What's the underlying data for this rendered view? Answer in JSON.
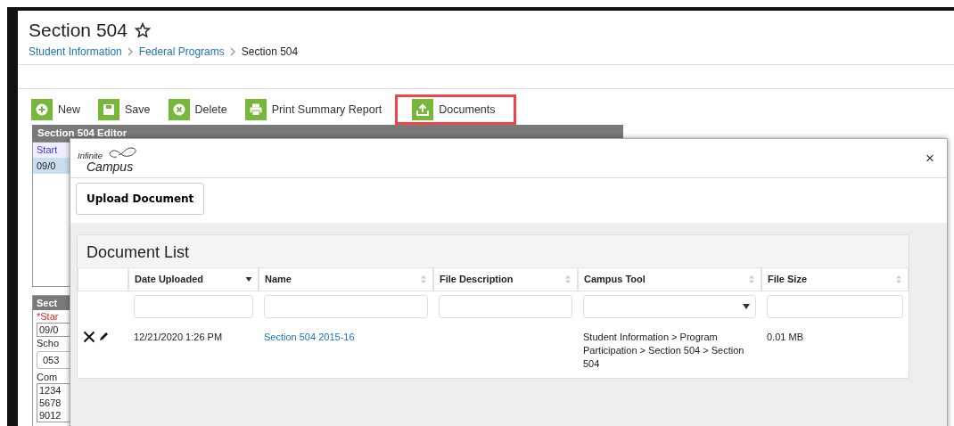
{
  "page": {
    "title": "Section 504",
    "breadcrumb": [
      {
        "label": "Student Information",
        "kind": "link"
      },
      {
        "label": "Federal Programs",
        "kind": "link"
      },
      {
        "label": "Section 504",
        "kind": "current"
      }
    ]
  },
  "toolbar": [
    {
      "label": "New",
      "kind": "new",
      "highlighted": false
    },
    {
      "label": "Save",
      "kind": "save",
      "highlighted": false
    },
    {
      "label": "Delete",
      "kind": "delete",
      "highlighted": false
    },
    {
      "label": "Print Summary Report",
      "kind": "print",
      "highlighted": false
    },
    {
      "label": "Documents",
      "kind": "upload",
      "highlighted": true
    }
  ],
  "editor": {
    "title": "Section 504 Editor",
    "list_header": "Start",
    "list_rows": [
      {
        "text": "09/0",
        "selected": true
      }
    ]
  },
  "detail": {
    "title": "Sect",
    "required_label": "*Star",
    "date": "09/0",
    "school_label": "Scho",
    "school_value": "053",
    "comments_label": "Com",
    "comments": [
      "1234",
      "5678",
      "9012"
    ]
  },
  "modal": {
    "logo_lines": [
      "Infinite",
      "Campus"
    ],
    "close": "×",
    "upload_button": "Upload Document",
    "list_title": "Document List",
    "columns": [
      {
        "label": "Date Uploaded",
        "sorted": true
      },
      {
        "label": "Name",
        "sorted": false
      },
      {
        "label": "File Description",
        "sorted": false
      },
      {
        "label": "Campus Tool",
        "sorted": false
      },
      {
        "label": "File Size",
        "sorted": false
      }
    ],
    "filters": [
      {
        "kind": "text"
      },
      {
        "kind": "text"
      },
      {
        "kind": "text"
      },
      {
        "kind": "select"
      },
      {
        "kind": "text"
      }
    ],
    "rows": [
      {
        "date": "12/21/2020 1:26 PM",
        "name": "Section 504 2015-16",
        "campus_tool": "Student Information > Program Participation > Section 504 > Section 504",
        "file_size": "0.01 MB"
      }
    ]
  }
}
